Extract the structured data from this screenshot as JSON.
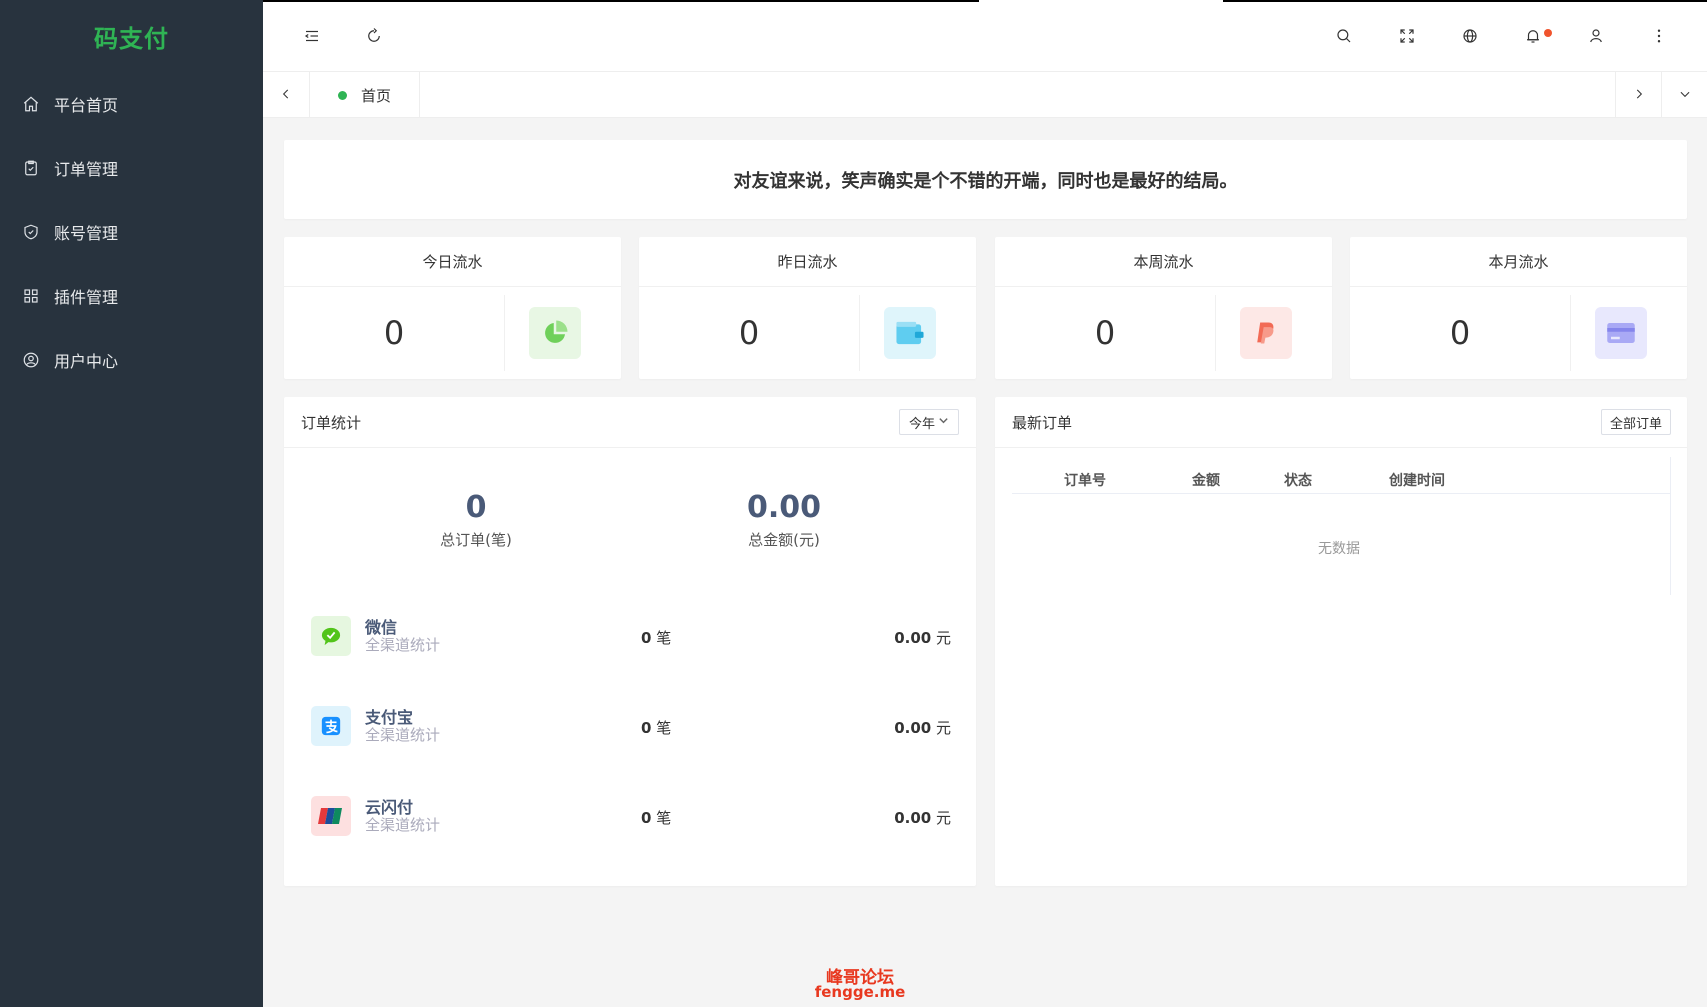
{
  "app": {
    "brand": "码支付"
  },
  "sidebar": {
    "items": [
      {
        "label": "平台首页",
        "icon": "home-icon"
      },
      {
        "label": "订单管理",
        "icon": "clipboard-icon"
      },
      {
        "label": "账号管理",
        "icon": "shield-icon"
      },
      {
        "label": "插件管理",
        "icon": "grid-icon"
      },
      {
        "label": "用户中心",
        "icon": "user-circle-icon"
      }
    ]
  },
  "header": {
    "icons": [
      "menu-fold-icon",
      "refresh-icon",
      "search-icon",
      "fullscreen-icon",
      "globe-icon",
      "bell-icon",
      "user-icon",
      "more-icon"
    ]
  },
  "tabs": {
    "home_label": "首页"
  },
  "banner": {
    "text": "对友谊来说，笑声确实是个不错的开端，同时也是最好的结局。"
  },
  "stats": [
    {
      "title": "今日流水",
      "value": "0",
      "icon": "pie-chart-icon",
      "color": "#54c35a",
      "bg": "#e8f7e4"
    },
    {
      "title": "昨日流水",
      "value": "0",
      "icon": "wallet-icon",
      "color": "#2bb9e6",
      "bg": "#dff5fb"
    },
    {
      "title": "本周流水",
      "value": "0",
      "icon": "paypal-icon",
      "color": "#f05a4a",
      "bg": "#fde8e6"
    },
    {
      "title": "本月流水",
      "value": "0",
      "icon": "card-icon",
      "color": "#8c8cf0",
      "bg": "#e8e8fd"
    }
  ],
  "order_stats": {
    "title": "订单统计",
    "range": "今年",
    "total_orders": "0",
    "total_orders_label": "总订单(笔)",
    "total_amount": "0.00",
    "total_amount_label": "总金额(元)",
    "channels": [
      {
        "name": "微信",
        "sub": "全渠道统计",
        "count": "0",
        "count_unit": "笔",
        "amount": "0.00",
        "amount_unit": "元",
        "icon": "wechat-icon",
        "color": "#52c41a",
        "bg": "#e6f7e0"
      },
      {
        "name": "支付宝",
        "sub": "全渠道统计",
        "count": "0",
        "count_unit": "笔",
        "amount": "0.00",
        "amount_unit": "元",
        "icon": "alipay-icon",
        "color": "#1890ff",
        "bg": "#dff3fc"
      },
      {
        "name": "云闪付",
        "sub": "全渠道统计",
        "count": "0",
        "count_unit": "笔",
        "amount": "0.00",
        "amount_unit": "元",
        "icon": "unionpay-icon",
        "color": "#e4393c",
        "bg": "#fde0e0"
      }
    ]
  },
  "latest_orders": {
    "title": "最新订单",
    "all_button": "全部订单",
    "columns": [
      "订单号",
      "金额",
      "状态",
      "创建时间"
    ],
    "empty_text": "无数据"
  },
  "watermark": {
    "line1": "峰哥论坛",
    "line2": "fengge.me"
  }
}
